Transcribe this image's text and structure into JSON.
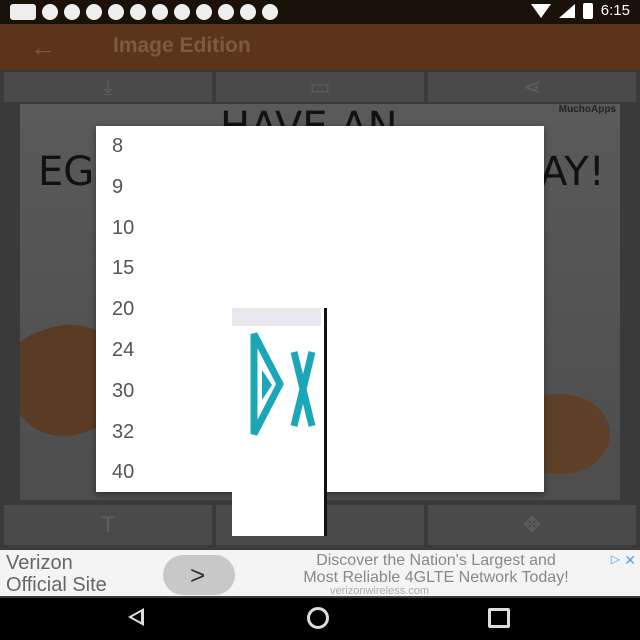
{
  "status_bar": {
    "time": "6:15"
  },
  "toolbar": {
    "title": "Image Edition"
  },
  "canvas": {
    "brand": "MuchoApps",
    "caption_left": "EGG",
    "caption_top": "HAVE AN",
    "caption_right": "AY!"
  },
  "dropdown": {
    "options": [
      "8",
      "9",
      "10",
      "15",
      "20",
      "24",
      "30",
      "32",
      "40"
    ]
  },
  "ad": {
    "left_line1": "Verizon",
    "left_line2": "Official Site",
    "button": ">",
    "right_line1": "Discover the Nation's Largest and",
    "right_line2": "Most Reliable 4GLTE Network Today!",
    "url": "verizonwireless.com"
  },
  "colors": {
    "toolbar": "#5c3419",
    "logo_teal": "#1ba7b8"
  }
}
